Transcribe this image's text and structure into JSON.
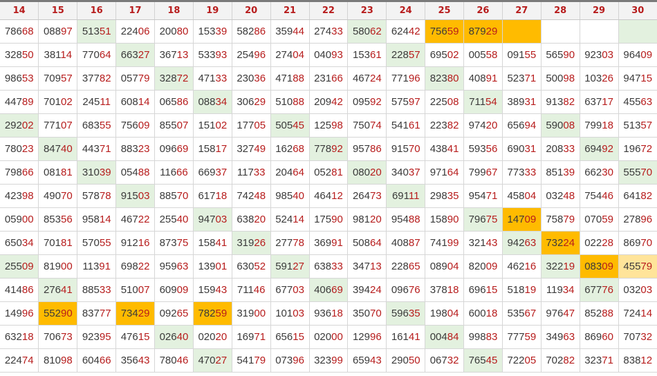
{
  "headers": [
    "14",
    "15",
    "16",
    "17",
    "18",
    "19",
    "20",
    "21",
    "22",
    "23",
    "24",
    "25",
    "26",
    "27",
    "28",
    "29",
    "30"
  ],
  "rows": [
    [
      "78668",
      "08897",
      "51351",
      "22406",
      "20080",
      "15339",
      "58286",
      "35944",
      "27433",
      "58062",
      "62442",
      "75659",
      "87929",
      "",
      "",
      "",
      ""
    ],
    [
      "32850",
      "38114",
      "77064",
      "66327",
      "36713",
      "53393",
      "25496",
      "27404",
      "04093",
      "15361",
      "22857",
      "69502",
      "00558",
      "09155",
      "56590",
      "92303",
      "96409"
    ],
    [
      "98653",
      "70957",
      "37782",
      "05779",
      "32872",
      "47133",
      "23036",
      "47188",
      "23166",
      "46724",
      "77196",
      "82380",
      "40891",
      "52371",
      "50098",
      "10326",
      "94715"
    ],
    [
      "44789",
      "70102",
      "24511",
      "60814",
      "06586",
      "08834",
      "30629",
      "51088",
      "20942",
      "09592",
      "57597",
      "22508",
      "71154",
      "38931",
      "91382",
      "63717",
      "45563"
    ],
    [
      "29202",
      "77107",
      "68355",
      "75609",
      "85507",
      "15102",
      "17705",
      "50545",
      "12598",
      "75074",
      "54161",
      "22382",
      "97420",
      "65694",
      "59008",
      "79918",
      "51357"
    ],
    [
      "78023",
      "84740",
      "44371",
      "88323",
      "09669",
      "15817",
      "32749",
      "16268",
      "77892",
      "95786",
      "91570",
      "43841",
      "59356",
      "69031",
      "20833",
      "69492",
      "19672"
    ],
    [
      "79866",
      "08181",
      "31039",
      "05488",
      "11666",
      "66937",
      "11733",
      "20464",
      "05281",
      "08020",
      "34037",
      "97164",
      "79967",
      "77333",
      "85139",
      "66230",
      "55570"
    ],
    [
      "42398",
      "49070",
      "57878",
      "91503",
      "88570",
      "61718",
      "74248",
      "98540",
      "46412",
      "26473",
      "69111",
      "29835",
      "95471",
      "45804",
      "03248",
      "75446",
      "64182"
    ],
    [
      "05900",
      "85356",
      "95814",
      "46722",
      "25540",
      "94703",
      "63820",
      "52414",
      "17590",
      "98120",
      "95488",
      "15890",
      "79675",
      "14709",
      "75879",
      "07059",
      "27896"
    ],
    [
      "65034",
      "70181",
      "57055",
      "91216",
      "87375",
      "15841",
      "31926",
      "27778",
      "36991",
      "50864",
      "40887",
      "74199",
      "32143",
      "94263",
      "73224",
      "02228",
      "86970"
    ],
    [
      "25509",
      "81900",
      "11391",
      "69822",
      "95963",
      "13901",
      "63052",
      "59127",
      "63833",
      "34713",
      "22865",
      "08904",
      "82009",
      "46216",
      "32219",
      "08309",
      "45579"
    ],
    [
      "41486",
      "27641",
      "88533",
      "51007",
      "60909",
      "15943",
      "71146",
      "67703",
      "40669",
      "39424",
      "09676",
      "37818",
      "69615",
      "51819",
      "11934",
      "67776",
      "03203"
    ],
    [
      "14996",
      "55290",
      "83777",
      "73429",
      "09265",
      "78259",
      "31900",
      "10103",
      "93618",
      "35070",
      "59635",
      "19804",
      "60018",
      "53567",
      "97647",
      "85288",
      "72414"
    ],
    [
      "63218",
      "70673",
      "92395",
      "47615",
      "02640",
      "02020",
      "16971",
      "65615",
      "02000",
      "12996",
      "16141",
      "00484",
      "99883",
      "77759",
      "34963",
      "86960",
      "70732"
    ],
    [
      "22474",
      "81098",
      "60466",
      "35643",
      "78046",
      "47027",
      "54179",
      "07396",
      "32399",
      "65943",
      "29050",
      "06732",
      "76545",
      "72205",
      "70282",
      "32371",
      "83812"
    ]
  ],
  "highlight_colors": {
    "green": "#e3f1df",
    "orange": "#ffbb00",
    "light_orange": "#ffe49a"
  },
  "highlights": [
    [
      "",
      "",
      "g",
      "",
      "",
      "",
      "",
      "",
      "",
      "g",
      "",
      "o",
      "o",
      "o",
      "",
      "",
      "g"
    ],
    [
      "",
      "",
      "",
      "g",
      "",
      "",
      "",
      "",
      "",
      "",
      "g",
      "",
      "",
      "",
      "",
      "",
      ""
    ],
    [
      "",
      "",
      "",
      "",
      "g",
      "",
      "",
      "",
      "",
      "",
      "",
      "g",
      "",
      "",
      "",
      "",
      ""
    ],
    [
      "",
      "",
      "",
      "",
      "",
      "g",
      "",
      "",
      "",
      "",
      "",
      "",
      "g",
      "",
      "",
      "",
      ""
    ],
    [
      "g",
      "",
      "",
      "",
      "",
      "",
      "",
      "g",
      "",
      "",
      "",
      "",
      "",
      "",
      "g",
      "",
      ""
    ],
    [
      "",
      "g",
      "",
      "",
      "",
      "",
      "",
      "",
      "g",
      "",
      "",
      "",
      "",
      "",
      "",
      "g",
      ""
    ],
    [
      "",
      "",
      "g",
      "",
      "",
      "",
      "",
      "",
      "",
      "g",
      "",
      "",
      "",
      "",
      "",
      "",
      "g"
    ],
    [
      "",
      "",
      "",
      "g",
      "",
      "",
      "",
      "",
      "",
      "",
      "g",
      "",
      "",
      "",
      "",
      "",
      ""
    ],
    [
      "",
      "",
      "",
      "",
      "",
      "g",
      "",
      "",
      "",
      "",
      "",
      "",
      "g",
      "o",
      "",
      "",
      ""
    ],
    [
      "",
      "",
      "",
      "",
      "",
      "",
      "g",
      "",
      "",
      "",
      "",
      "",
      "",
      "g",
      "o",
      "",
      ""
    ],
    [
      "g",
      "",
      "",
      "",
      "",
      "",
      "",
      "g",
      "",
      "",
      "",
      "",
      "",
      "",
      "g",
      "o",
      "y"
    ],
    [
      "",
      "g",
      "",
      "",
      "",
      "",
      "",
      "",
      "g",
      "",
      "",
      "",
      "",
      "",
      "",
      "g",
      ""
    ],
    [
      "",
      "o",
      "",
      "o",
      "",
      "o",
      "",
      "",
      "",
      "",
      "g",
      "",
      "",
      "",
      "",
      "",
      ""
    ],
    [
      "",
      "",
      "",
      "",
      "g",
      "",
      "",
      "",
      "",
      "",
      "",
      "g",
      "",
      "",
      "",
      "",
      ""
    ],
    [
      "",
      "",
      "",
      "",
      "",
      "g",
      "",
      "",
      "",
      "",
      "",
      "",
      "g",
      "",
      "",
      "",
      ""
    ]
  ]
}
